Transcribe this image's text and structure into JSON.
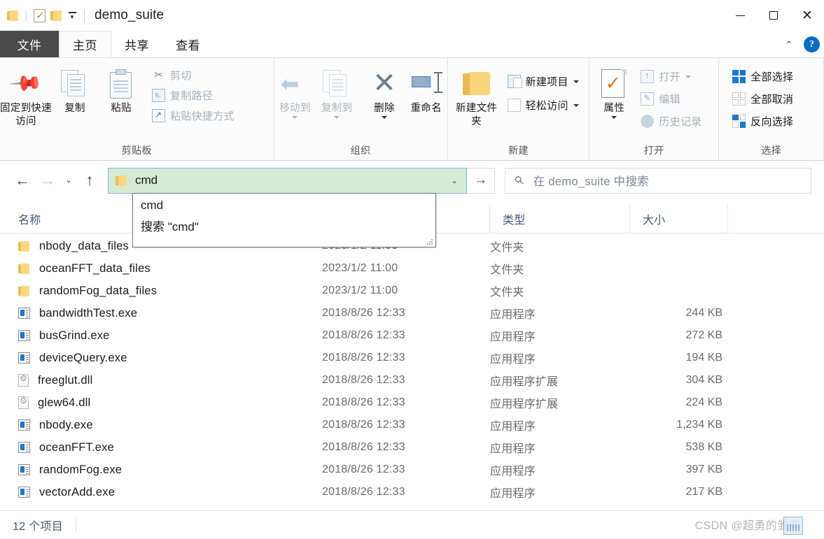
{
  "window": {
    "title": "demo_suite",
    "quick_access": [
      {
        "name": "folder-icon",
        "label": ""
      },
      {
        "name": "properties-icon",
        "label": ""
      },
      {
        "name": "new-folder-icon",
        "label": ""
      },
      {
        "name": "customize-caret-icon",
        "label": ""
      }
    ],
    "controls": {
      "minimize": "—",
      "maximize": "□",
      "close": "✕"
    }
  },
  "ribbon": {
    "tabs": [
      {
        "label": "文件",
        "id": "file",
        "active": false
      },
      {
        "label": "主页",
        "id": "home",
        "active": true
      },
      {
        "label": "共享",
        "id": "share",
        "active": false
      },
      {
        "label": "查看",
        "id": "view",
        "active": false
      }
    ],
    "collapse_label": "⌃",
    "help_label": "?",
    "groups": [
      {
        "name": "clipboard",
        "label": "剪贴板",
        "big_buttons": [
          {
            "label": "固定到快速访问",
            "icon": "pin-icon"
          },
          {
            "label": "复制",
            "icon": "copy-icon"
          },
          {
            "label": "粘贴",
            "icon": "paste-icon"
          }
        ],
        "small_buttons": [
          {
            "label": "剪切",
            "icon": "scissors-icon",
            "disabled": true
          },
          {
            "label": "复制路径",
            "icon": "copy-path-icon",
            "disabled": true
          },
          {
            "label": "粘贴快捷方式",
            "icon": "paste-shortcut-icon",
            "disabled": true
          }
        ]
      },
      {
        "name": "organize",
        "label": "组织",
        "big_buttons": [
          {
            "label": "移动到",
            "icon": "move-to-icon",
            "has_caret": true,
            "disabled": true
          },
          {
            "label": "复制到",
            "icon": "copy-to-icon",
            "has_caret": true,
            "disabled": true
          },
          {
            "label": "删除",
            "icon": "delete-icon",
            "has_caret": true
          },
          {
            "label": "重命名",
            "icon": "rename-icon"
          }
        ]
      },
      {
        "name": "new",
        "label": "新建",
        "big_buttons": [
          {
            "label": "新建文件夹",
            "icon": "new-folder-icon"
          }
        ],
        "small_buttons": [
          {
            "label": "新建项目",
            "icon": "new-item-icon",
            "has_caret": true
          },
          {
            "label": "轻松访问",
            "icon": "easy-access-icon",
            "has_caret": true
          }
        ]
      },
      {
        "name": "open",
        "label": "打开",
        "big_buttons": [
          {
            "label": "属性",
            "icon": "properties-icon",
            "has_caret": true
          }
        ],
        "small_buttons": [
          {
            "label": "打开",
            "icon": "open-icon",
            "has_caret": true,
            "disabled": true
          },
          {
            "label": "编辑",
            "icon": "edit-icon",
            "disabled": true
          },
          {
            "label": "历史记录",
            "icon": "history-icon",
            "disabled": true
          }
        ]
      },
      {
        "name": "select",
        "label": "选择",
        "small_buttons": [
          {
            "label": "全部选择",
            "icon": "select-all-icon"
          },
          {
            "label": "全部取消",
            "icon": "select-none-icon"
          },
          {
            "label": "反向选择",
            "icon": "invert-selection-icon"
          }
        ]
      }
    ]
  },
  "navbar": {
    "back_label": "←",
    "forward_label": "→",
    "recent_label": "⌄",
    "up_label": "↑",
    "address_value": "cmd",
    "address_dropdown_label": "⌄",
    "go_label": "→",
    "search_placeholder": "在 demo_suite 中搜索",
    "search_value": ""
  },
  "autocomplete": {
    "items": [
      {
        "label": "cmd"
      },
      {
        "label": "搜索 \"cmd\""
      }
    ]
  },
  "columns": [
    {
      "key": "name",
      "label": "名称"
    },
    {
      "key": "date",
      "label": ""
    },
    {
      "key": "type",
      "label": "类型"
    },
    {
      "key": "size",
      "label": "大小"
    }
  ],
  "files": [
    {
      "name": "nbody_data_files",
      "date": "2023/1/2 11:00",
      "type": "文件夹",
      "size": "",
      "icon": "folder-icon"
    },
    {
      "name": "oceanFFT_data_files",
      "date": "2023/1/2 11:00",
      "type": "文件夹",
      "size": "",
      "icon": "folder-icon"
    },
    {
      "name": "randomFog_data_files",
      "date": "2023/1/2 11:00",
      "type": "文件夹",
      "size": "",
      "icon": "folder-icon"
    },
    {
      "name": "bandwidthTest.exe",
      "date": "2018/8/26 12:33",
      "type": "应用程序",
      "size": "244 KB",
      "icon": "exe-icon"
    },
    {
      "name": "busGrind.exe",
      "date": "2018/8/26 12:33",
      "type": "应用程序",
      "size": "272 KB",
      "icon": "exe-icon"
    },
    {
      "name": "deviceQuery.exe",
      "date": "2018/8/26 12:33",
      "type": "应用程序",
      "size": "194 KB",
      "icon": "exe-icon"
    },
    {
      "name": "freeglut.dll",
      "date": "2018/8/26 12:33",
      "type": "应用程序扩展",
      "size": "304 KB",
      "icon": "dll-icon"
    },
    {
      "name": "glew64.dll",
      "date": "2018/8/26 12:33",
      "type": "应用程序扩展",
      "size": "224 KB",
      "icon": "dll-icon"
    },
    {
      "name": "nbody.exe",
      "date": "2018/8/26 12:33",
      "type": "应用程序",
      "size": "1,234 KB",
      "icon": "exe-icon"
    },
    {
      "name": "oceanFFT.exe",
      "date": "2018/8/26 12:33",
      "type": "应用程序",
      "size": "538 KB",
      "icon": "exe-icon"
    },
    {
      "name": "randomFog.exe",
      "date": "2018/8/26 12:33",
      "type": "应用程序",
      "size": "397 KB",
      "icon": "exe-icon"
    },
    {
      "name": "vectorAdd.exe",
      "date": "2018/8/26 12:33",
      "type": "应用程序",
      "size": "217 KB",
      "icon": "exe-icon"
    }
  ],
  "statusbar": {
    "item_count": "12 个项目",
    "watermark": "CSDN @超勇的雏菊"
  },
  "colors": {
    "accent": "#1878d4",
    "address_selection": "#d6ebd4",
    "file_tab": "#4a4a4a",
    "folder_yellow": "#fbd477",
    "header_text": "#3c5a75"
  }
}
